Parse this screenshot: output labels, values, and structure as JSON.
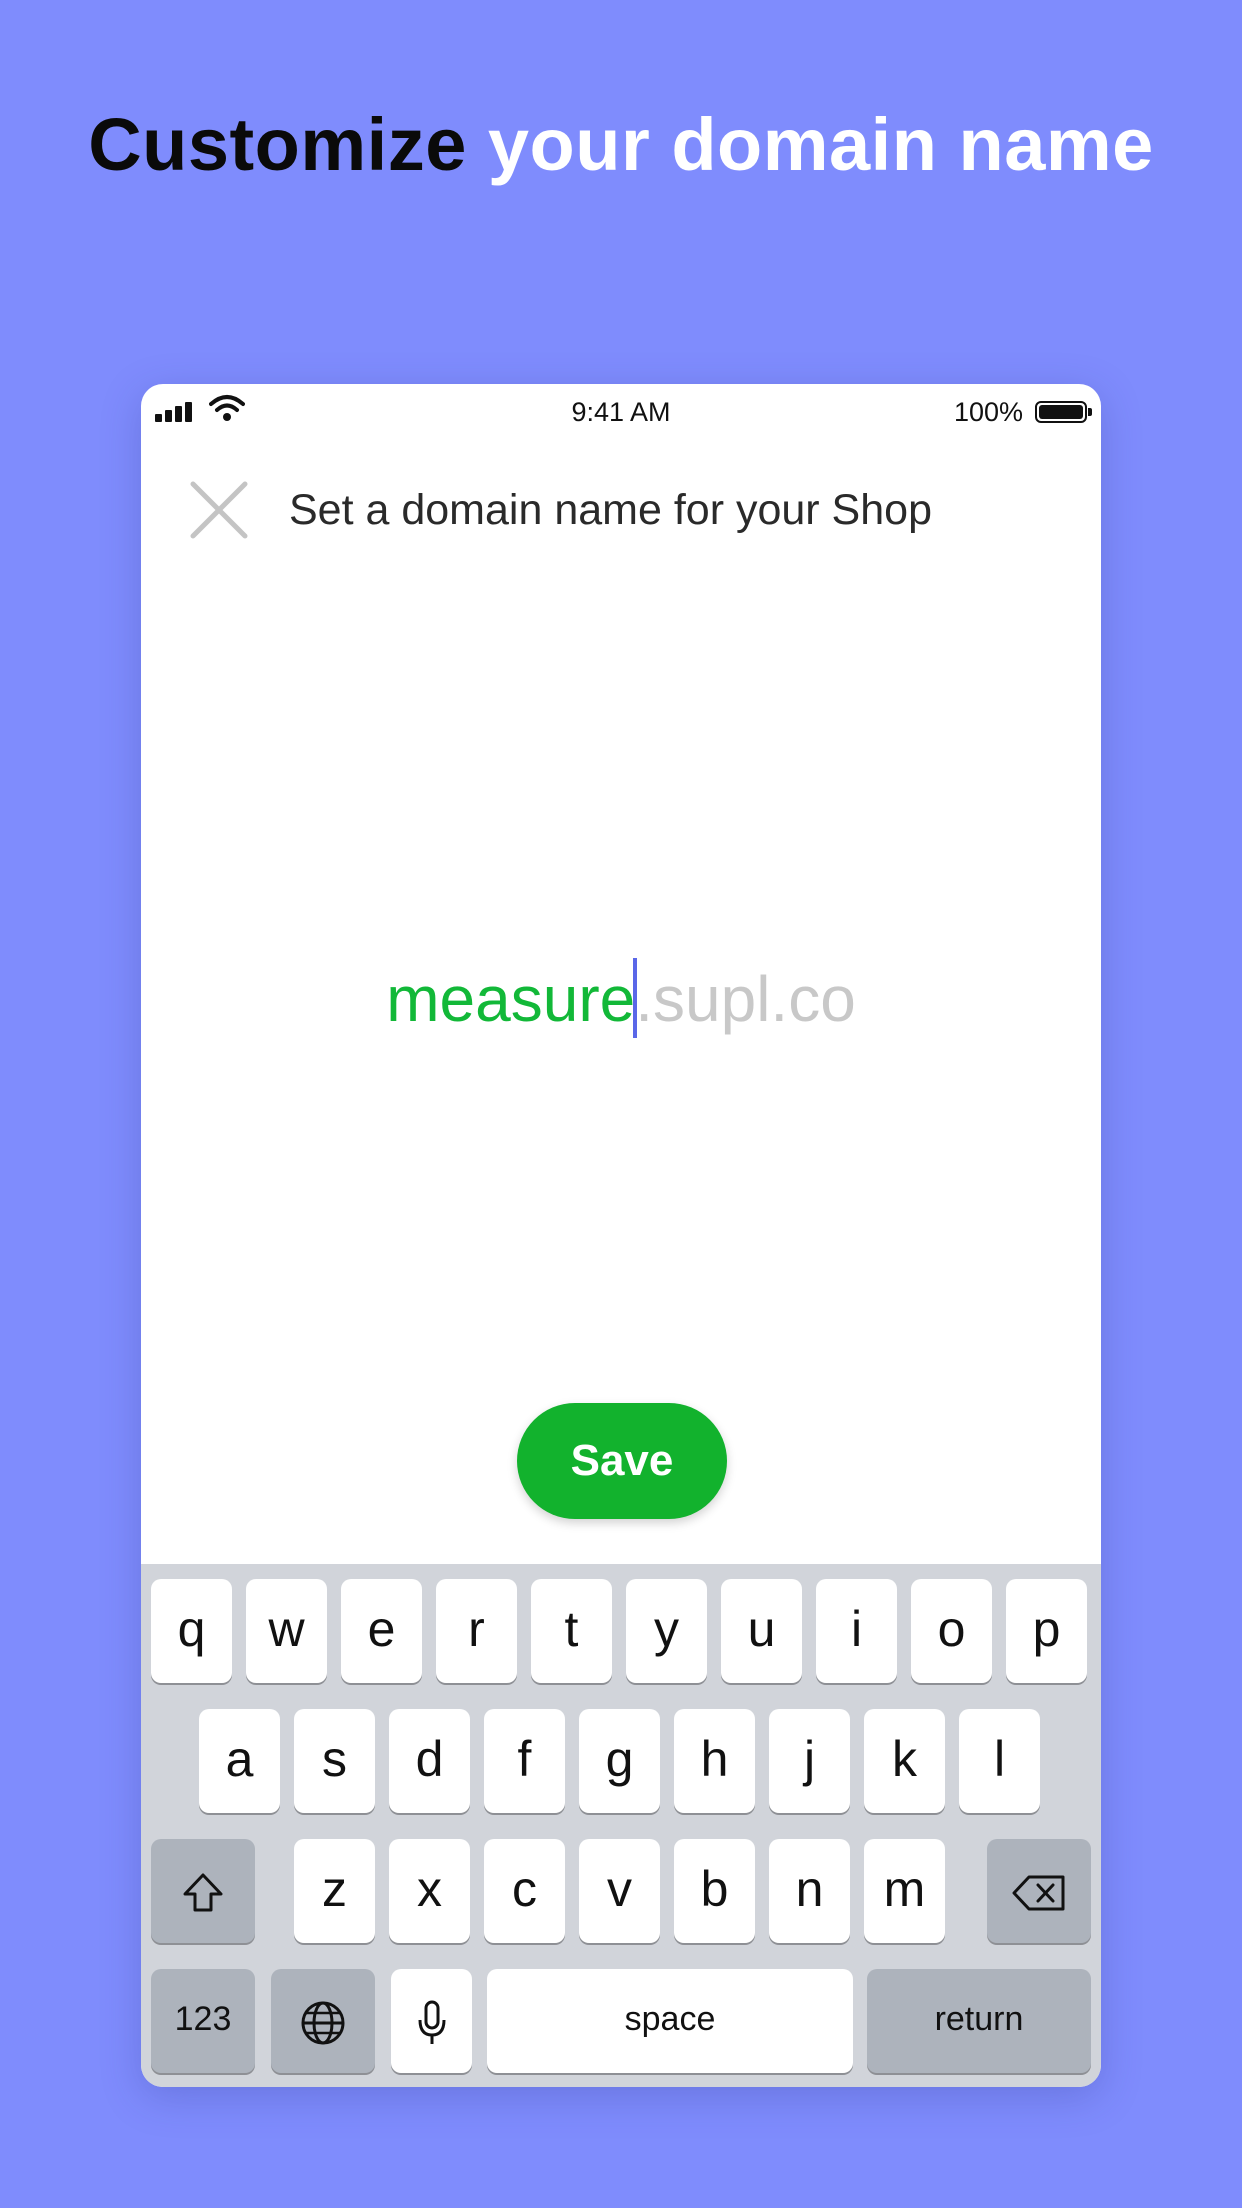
{
  "headline": {
    "part1": "Customize",
    "part2": " your domain name"
  },
  "status_bar": {
    "time": "9:41 AM",
    "battery": "100%"
  },
  "nav": {
    "title": "Set a domain name for your Shop",
    "close_icon": "close-icon"
  },
  "domain": {
    "value": "measure",
    "suffix": ".supl.co"
  },
  "save_button": {
    "label": "Save"
  },
  "keyboard": {
    "row1": [
      "q",
      "w",
      "e",
      "r",
      "t",
      "y",
      "u",
      "i",
      "o",
      "p"
    ],
    "row2": [
      "a",
      "s",
      "d",
      "f",
      "g",
      "h",
      "j",
      "k",
      "l"
    ],
    "row3": [
      "z",
      "x",
      "c",
      "v",
      "b",
      "n",
      "m"
    ],
    "numbers": "123",
    "space": "space",
    "return": "return",
    "icons": [
      "shift-icon",
      "backspace-icon",
      "globe-icon",
      "microphone-icon"
    ]
  },
  "colors": {
    "background": "#7F8CFD",
    "accent_green": "#12B22D",
    "domain_text": "#12B838",
    "suffix_text": "#C8C8C8",
    "cursor": "#5A67E8"
  }
}
